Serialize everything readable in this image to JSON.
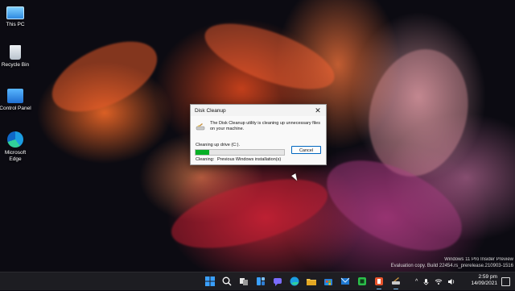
{
  "desktop": {
    "icons": [
      {
        "label": "This PC",
        "icon": "this-pc-icon"
      },
      {
        "label": "Recycle Bin",
        "icon": "recycle-bin-icon"
      },
      {
        "label": "Control Panel",
        "icon": "control-panel-icon"
      },
      {
        "label": "Microsoft Edge",
        "icon": "edge-icon"
      }
    ]
  },
  "dialog": {
    "title": "Disk Cleanup",
    "close_label": "✕",
    "message": "The Disk Cleanup utility is cleaning up unnecessary files on your machine.",
    "status": "Cleaning up drive  (C:).",
    "progress_fraction": 0.15,
    "progress_color": "#06b025",
    "cancel_label": "Cancel",
    "cleaning_label": "Cleaning:",
    "cleaning_value": "Previous Windows installation(s)"
  },
  "watermark": {
    "line1": "Windows 11 Pro Insider Preview",
    "line2": "Evaluation copy. Build 22454.rs_prerelease.210903-1516"
  },
  "taskbar": {
    "apps": [
      "start-icon",
      "search-icon",
      "task-view-icon",
      "widgets-icon",
      "chat-icon",
      "edge-icon",
      "file-explorer-icon",
      "store-icon",
      "mail-icon",
      "app-green-icon",
      "app-orange-icon",
      "disk-cleanup-icon"
    ],
    "tray_chevron": "^",
    "clock_time": "2:59 pm",
    "clock_date": "14/09/2021"
  }
}
